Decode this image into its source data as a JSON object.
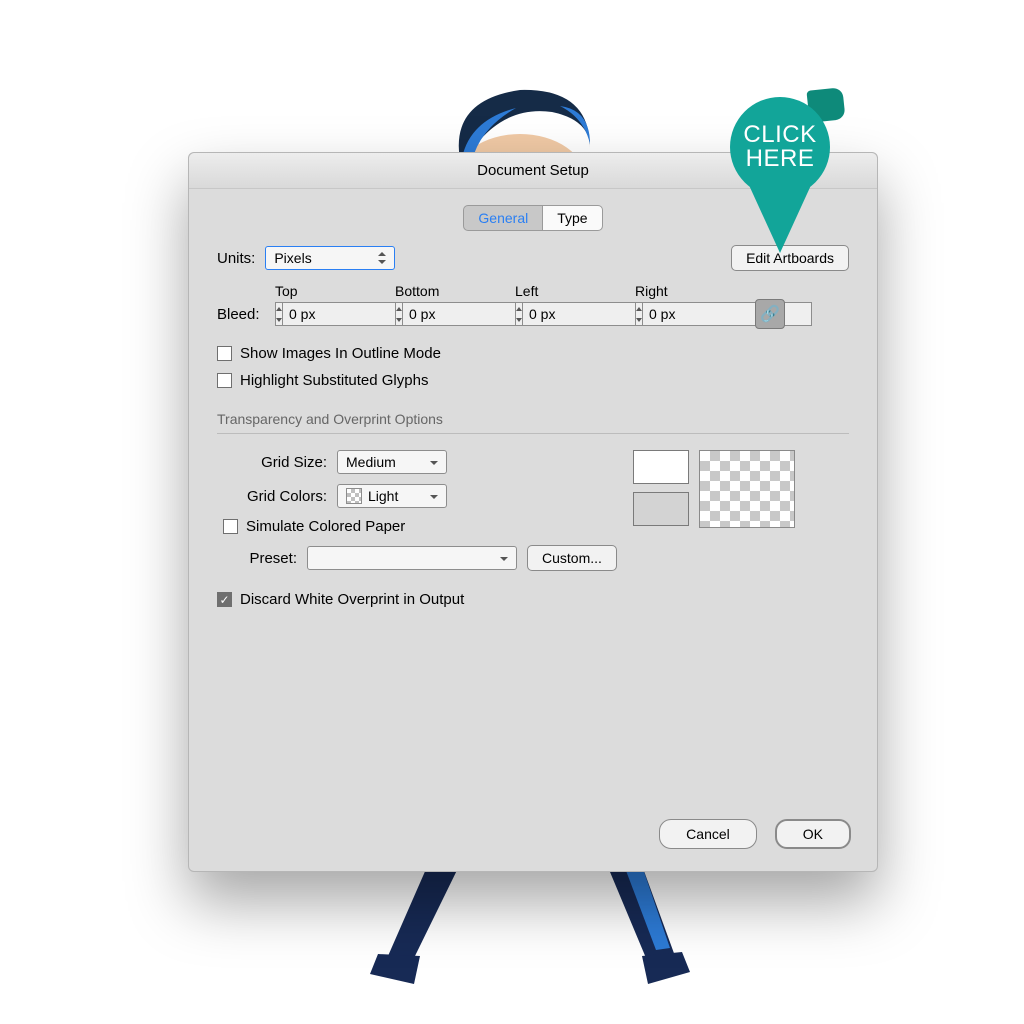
{
  "annotation": {
    "text": "CLICK\nHERE"
  },
  "dialog": {
    "title": "Document Setup",
    "tabs": {
      "general": "General",
      "type": "Type",
      "active": "General"
    },
    "units": {
      "label": "Units:",
      "value": "Pixels"
    },
    "edit_artboards": "Edit Artboards",
    "bleed": {
      "label": "Bleed:",
      "cols": {
        "top": "Top",
        "bottom": "Bottom",
        "left": "Left",
        "right": "Right"
      },
      "values": {
        "top": "0 px",
        "bottom": "0 px",
        "left": "0 px",
        "right": "0 px"
      },
      "link_icon": "🔗"
    },
    "checks": {
      "outline": {
        "label": "Show Images In Outline Mode",
        "checked": false
      },
      "glyphs": {
        "label": "Highlight Substituted Glyphs",
        "checked": false
      }
    },
    "transparency": {
      "title": "Transparency and Overprint Options",
      "grid_size": {
        "label": "Grid Size:",
        "value": "Medium"
      },
      "grid_colors": {
        "label": "Grid Colors:",
        "value": "Light"
      },
      "simulate": {
        "label": "Simulate Colored Paper",
        "checked": false
      },
      "preset": {
        "label": "Preset:",
        "value": ""
      },
      "custom_btn": "Custom...",
      "discard": {
        "label": "Discard White Overprint in Output",
        "checked": true,
        "checkmark": "✓"
      }
    },
    "buttons": {
      "cancel": "Cancel",
      "ok": "OK"
    }
  }
}
